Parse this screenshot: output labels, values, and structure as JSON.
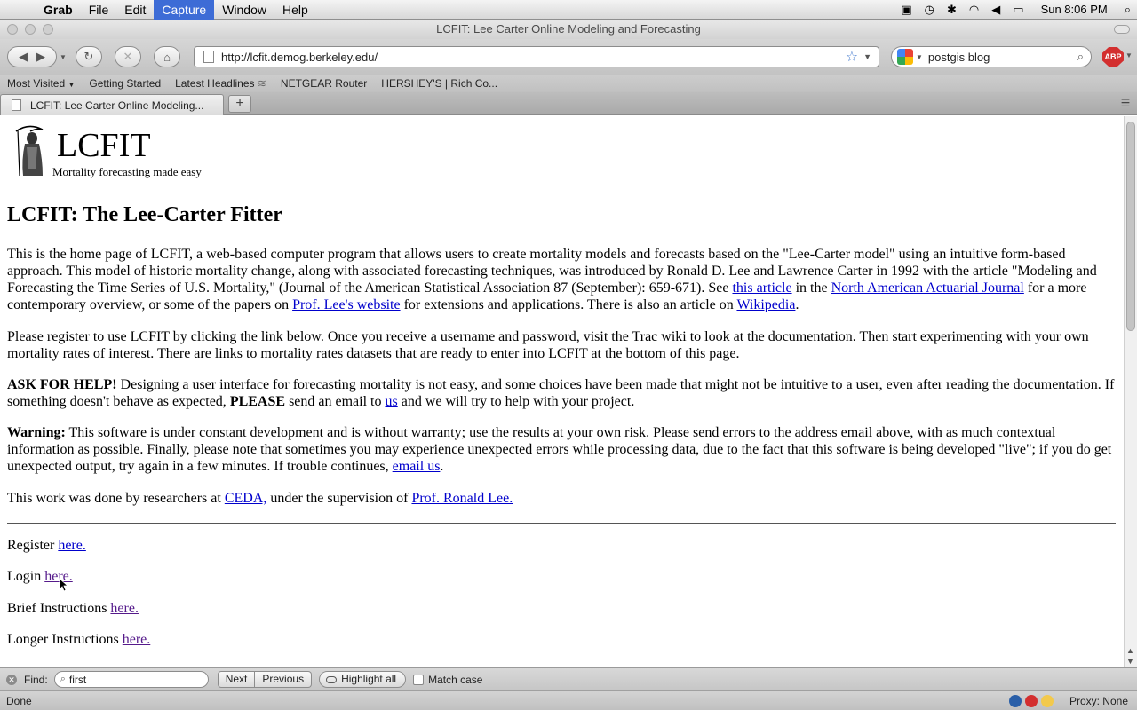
{
  "menubar": {
    "app": "Grab",
    "items": [
      "File",
      "Edit",
      "Capture",
      "Window",
      "Help"
    ],
    "clock": "Sun 8:06 PM"
  },
  "window": {
    "title": "LCFIT: Lee Carter Online Modeling and Forecasting"
  },
  "navbar": {
    "url": "http://lcfit.demog.berkeley.edu/",
    "search_query": "postgis blog",
    "adblock_label": "ABP"
  },
  "bookmarks": [
    "Most Visited",
    "Getting Started",
    "Latest Headlines",
    "NETGEAR Router",
    "HERSHEY'S | Rich Co..."
  ],
  "tab": {
    "title": "LCFIT: Lee Carter Online Modeling...",
    "new_tab": "+"
  },
  "page": {
    "brand": "LCFIT",
    "tagline": "Mortality forecasting made easy",
    "heading": "LCFIT: The Lee-Carter Fitter",
    "p1": {
      "a": "This is the home page of LCFIT, a web-based computer program that allows users to create mortality models and forecasts based on the \"Lee-Carter model\" using an intuitive form-based approach. This model of historic mortality change, along with associated forecasting techniques, was introduced by Ronald D. Lee and Lawrence Carter in 1992 with the article \"Modeling and Forecasting the Time Series of U.S. Mortality,\" (Journal of the American Statistical Association 87 (September): 659-671). See ",
      "link1": "this article",
      "b": " in the ",
      "link2": "North American Actuarial Journal",
      "c": " for a more contemporary overview, or some of the papers on ",
      "link3": "Prof. Lee's website",
      "d": " for extensions and applications. There is also an article on ",
      "link4": "Wikipedia",
      "e": "."
    },
    "p2": "Please register to use LCFIT by clicking the link below. Once you receive a username and password, visit the Trac wiki to look at the documentation. Then start experimenting with your own mortality rates of interest. There are links to mortality rates datasets that are ready to enter into LCFIT at the bottom of this page.",
    "p3": {
      "bold1": "ASK FOR HELP!",
      "a": " Designing a user interface for forecasting mortality is not easy, and some choices have been made that might not be intuitive to a user, even after reading the documentation. If something doesn't behave as expected, ",
      "bold2": "PLEASE",
      "b": " send an email to ",
      "link": "us",
      "c": " and we will try to help with your project."
    },
    "p4": {
      "bold": "Warning:",
      "a": " This software is under constant development and is without warranty; use the results at your own risk. Please send errors to the address email above, with as much contextual information as possible. Finally, please note that sometimes you may experience unexpected errors while processing data, due to the fact that this software is being developed \"live\"; if you do get unexpected output, try again in a few minutes. If trouble continues, ",
      "link": "email us",
      "b": "."
    },
    "p5": {
      "a": "This work was done by researchers at ",
      "link1": "CEDA,",
      "b": " under the supervision of ",
      "link2": "Prof. Ronald Lee."
    },
    "links": [
      {
        "label": "Register ",
        "link": "here."
      },
      {
        "label": "Login ",
        "link": "here."
      },
      {
        "label": "Brief Instructions ",
        "link": "here."
      },
      {
        "label": "Longer Instructions ",
        "link": "here."
      }
    ]
  },
  "findbar": {
    "label": "Find:",
    "value": "first",
    "next": "Next",
    "previous": "Previous",
    "highlight_all": "Highlight all",
    "match_case": "Match case"
  },
  "statusbar": {
    "status": "Done",
    "proxy": "Proxy: None"
  }
}
